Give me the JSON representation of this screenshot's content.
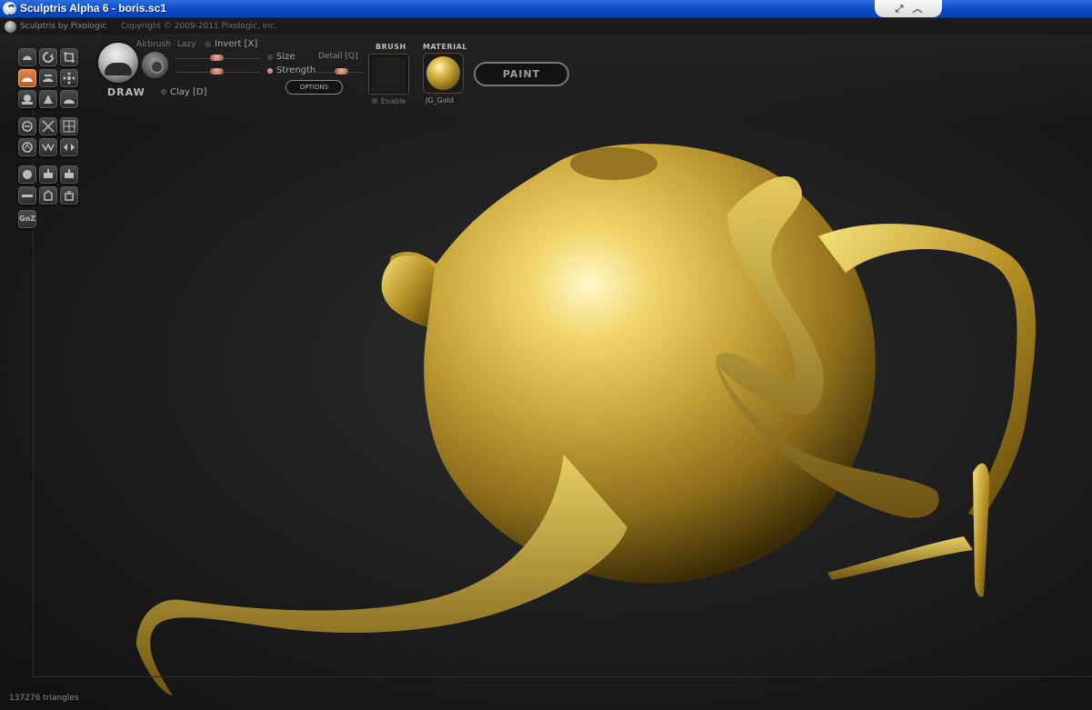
{
  "window": {
    "title": "Sculptris Alpha 6 - boris.sc1"
  },
  "header": {
    "brand": "Sculptris by Pixologic",
    "copyright": "Copyright © 2009-2011 Pixologic, Inc."
  },
  "brush": {
    "current_tool": "DRAW",
    "airbrush_label": "Airbrush",
    "lazy_label": "Lazy",
    "invert_label": "Invert [X]",
    "clay_label": "Clay [D]",
    "size_label": "Size",
    "strength_label": "Strength",
    "detail_label": "Detail [Q]",
    "options_label": "OPTIONS",
    "size_value": 0.5,
    "strength_value": 0.5,
    "detail_value": 0.45
  },
  "texture": {
    "brush_header": "BRUSH",
    "enable_label": "Enable"
  },
  "material": {
    "header": "MATERIAL",
    "name": "JG_Gold"
  },
  "mode": {
    "paint_label": "PAINT"
  },
  "toolbar": {
    "icons": [
      "clay-icon",
      "rotate-icon",
      "crop-icon",
      "draw-icon",
      "flatten-icon",
      "move-icon",
      "inflate-icon",
      "pinch-icon",
      "smooth-icon",
      "reduce-icon",
      "mask-icon",
      "grid-icon",
      "symmetry-icon",
      "wireframe-icon",
      "mirror-icon",
      "sphere-icon",
      "import-obj-icon",
      "export-obj-icon",
      "plane-icon",
      "save-icon",
      "open-icon",
      "goz-icon"
    ],
    "goz_label": "GoZ"
  },
  "status": {
    "triangles": "137276 triangles"
  },
  "colors": {
    "accent": "#c96b33",
    "gold": "#c9a83a",
    "titlebar": "#0a48c8"
  }
}
